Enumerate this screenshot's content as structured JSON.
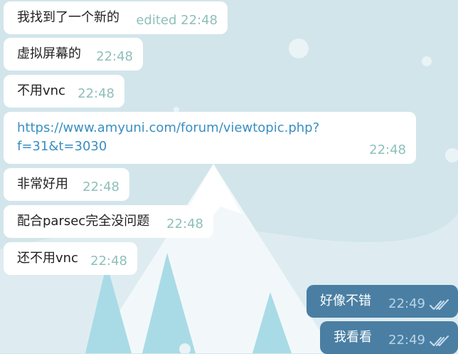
{
  "messages": [
    {
      "text": "我找到了一个新的",
      "time": "edited 22:48"
    },
    {
      "text": "虚拟屏幕的",
      "time": "22:48"
    },
    {
      "text": "不用vnc",
      "time": "22:48"
    },
    {
      "link_line1": "https://www.amyuni.com/forum/viewtopic.php?",
      "link_line2": "f=31&t=3030",
      "time": "22:48"
    },
    {
      "text": "非常好用",
      "time": "22:48"
    },
    {
      "text": "配合parsec完全没问题",
      "time": "22:48"
    },
    {
      "text": "还不用vnc",
      "time": "22:48"
    }
  ],
  "outgoing": [
    {
      "text": "好像不错",
      "time": "22:49",
      "status_icon": "double-check-icon"
    },
    {
      "text": "我看看",
      "time": "22:49",
      "status_icon": "double-check-icon"
    }
  ],
  "colors": {
    "incoming": "#ffffff",
    "outgoing": "#4a7fa3",
    "link": "#3a8fc2",
    "time_incoming": "#8ebfba"
  }
}
